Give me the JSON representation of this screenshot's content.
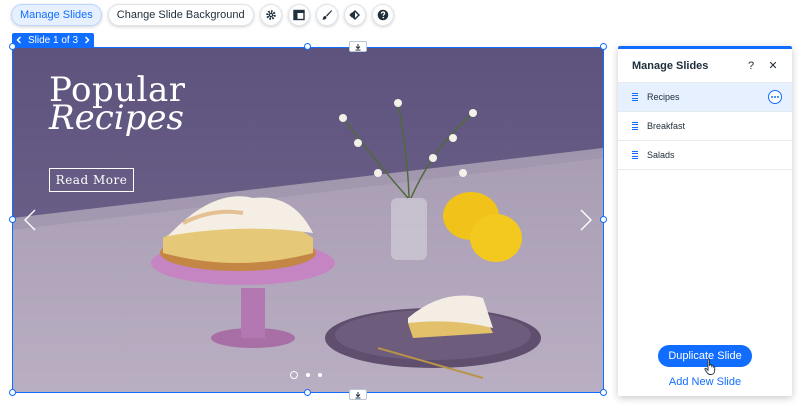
{
  "toolbar": {
    "manage_slides": "Manage Slides",
    "change_background": "Change Slide Background",
    "icons": [
      "gear-icon",
      "layout-icon",
      "design-brush-icon",
      "animation-icon",
      "help-icon"
    ]
  },
  "slide_tag": {
    "label": "Slide 1 of 3"
  },
  "slide": {
    "title_line1": "Popular",
    "title_line2": "Recipes",
    "button_label": "Read More",
    "dots_count": 3,
    "active_dot": 1
  },
  "panel": {
    "title": "Manage Slides",
    "help": "?",
    "close": "✕",
    "slides": [
      {
        "label": "Recipes",
        "selected": true
      },
      {
        "label": "Breakfast",
        "selected": false
      },
      {
        "label": "Salads",
        "selected": false
      }
    ],
    "duplicate_label": "Duplicate Slide",
    "add_label": "Add New Slide"
  },
  "colors": {
    "accent": "#116dff",
    "selected_row": "#e7f0ff",
    "slide_background": "#7d6f98"
  }
}
